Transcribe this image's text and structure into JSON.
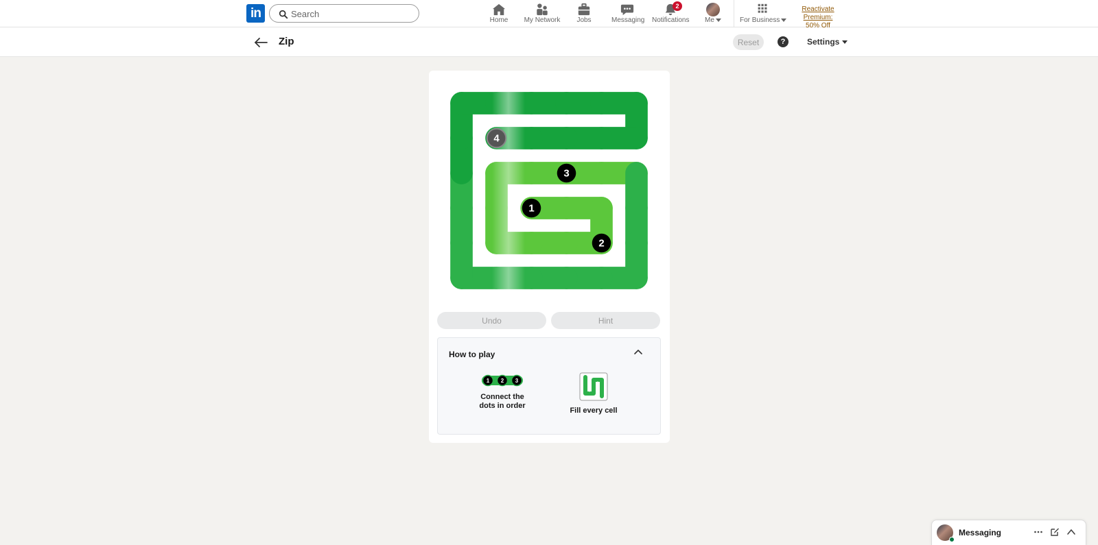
{
  "nav": {
    "search_placeholder": "Search",
    "items": [
      {
        "label": "Home",
        "icon": "home-icon"
      },
      {
        "label": "My Network",
        "icon": "network-icon"
      },
      {
        "label": "Jobs",
        "icon": "briefcase-icon"
      },
      {
        "label": "Messaging",
        "icon": "chat-icon"
      },
      {
        "label": "Notifications",
        "icon": "bell-icon",
        "badge": "2"
      },
      {
        "label": "Me",
        "icon": "avatar"
      },
      {
        "label": "For Business",
        "icon": "grid-icon"
      }
    ],
    "premium_line1": "Reactivate Premium:",
    "premium_line2": "50% Off"
  },
  "header": {
    "title": "Zip",
    "reset_label": "Reset",
    "help_label": "?",
    "settings_label": "Settings"
  },
  "board": {
    "rows": 6,
    "cols": 6,
    "path_colors": [
      "#16a33d",
      "#2db14a",
      "#5cc73c"
    ],
    "checkpoints": [
      {
        "label": "1",
        "row": 3,
        "col": 2
      },
      {
        "label": "2",
        "row": 4,
        "col": 4
      },
      {
        "label": "3",
        "row": 2,
        "col": 3
      },
      {
        "label": "4",
        "row": 1,
        "col": 1
      }
    ],
    "path": [
      [
        3,
        2
      ],
      [
        3,
        3
      ],
      [
        3,
        4
      ],
      [
        4,
        4
      ],
      [
        4,
        3
      ],
      [
        4,
        2
      ],
      [
        4,
        1
      ],
      [
        3,
        1
      ],
      [
        2,
        1
      ],
      [
        2,
        2
      ],
      [
        2,
        3
      ],
      [
        2,
        4
      ],
      [
        2,
        5
      ],
      [
        3,
        5
      ],
      [
        4,
        5
      ],
      [
        5,
        5
      ],
      [
        5,
        4
      ],
      [
        5,
        3
      ],
      [
        5,
        2
      ],
      [
        5,
        1
      ],
      [
        5,
        0
      ],
      [
        4,
        0
      ],
      [
        3,
        0
      ],
      [
        2,
        0
      ],
      [
        1,
        0
      ],
      [
        0,
        0
      ],
      [
        0,
        1
      ],
      [
        0,
        2
      ],
      [
        0,
        3
      ],
      [
        0,
        4
      ],
      [
        0,
        5
      ],
      [
        1,
        5
      ],
      [
        1,
        4
      ],
      [
        1,
        3
      ],
      [
        1,
        2
      ],
      [
        1,
        1
      ]
    ]
  },
  "controls": {
    "undo_label": "Undo",
    "hint_label": "Hint"
  },
  "how_to_play": {
    "title": "How to play",
    "dots": [
      "1",
      "2",
      "3"
    ],
    "rule1_line1": "Connect the",
    "rule1_line2": "dots in order",
    "rule2": "Fill every cell"
  },
  "messaging": {
    "label": "Messaging"
  }
}
